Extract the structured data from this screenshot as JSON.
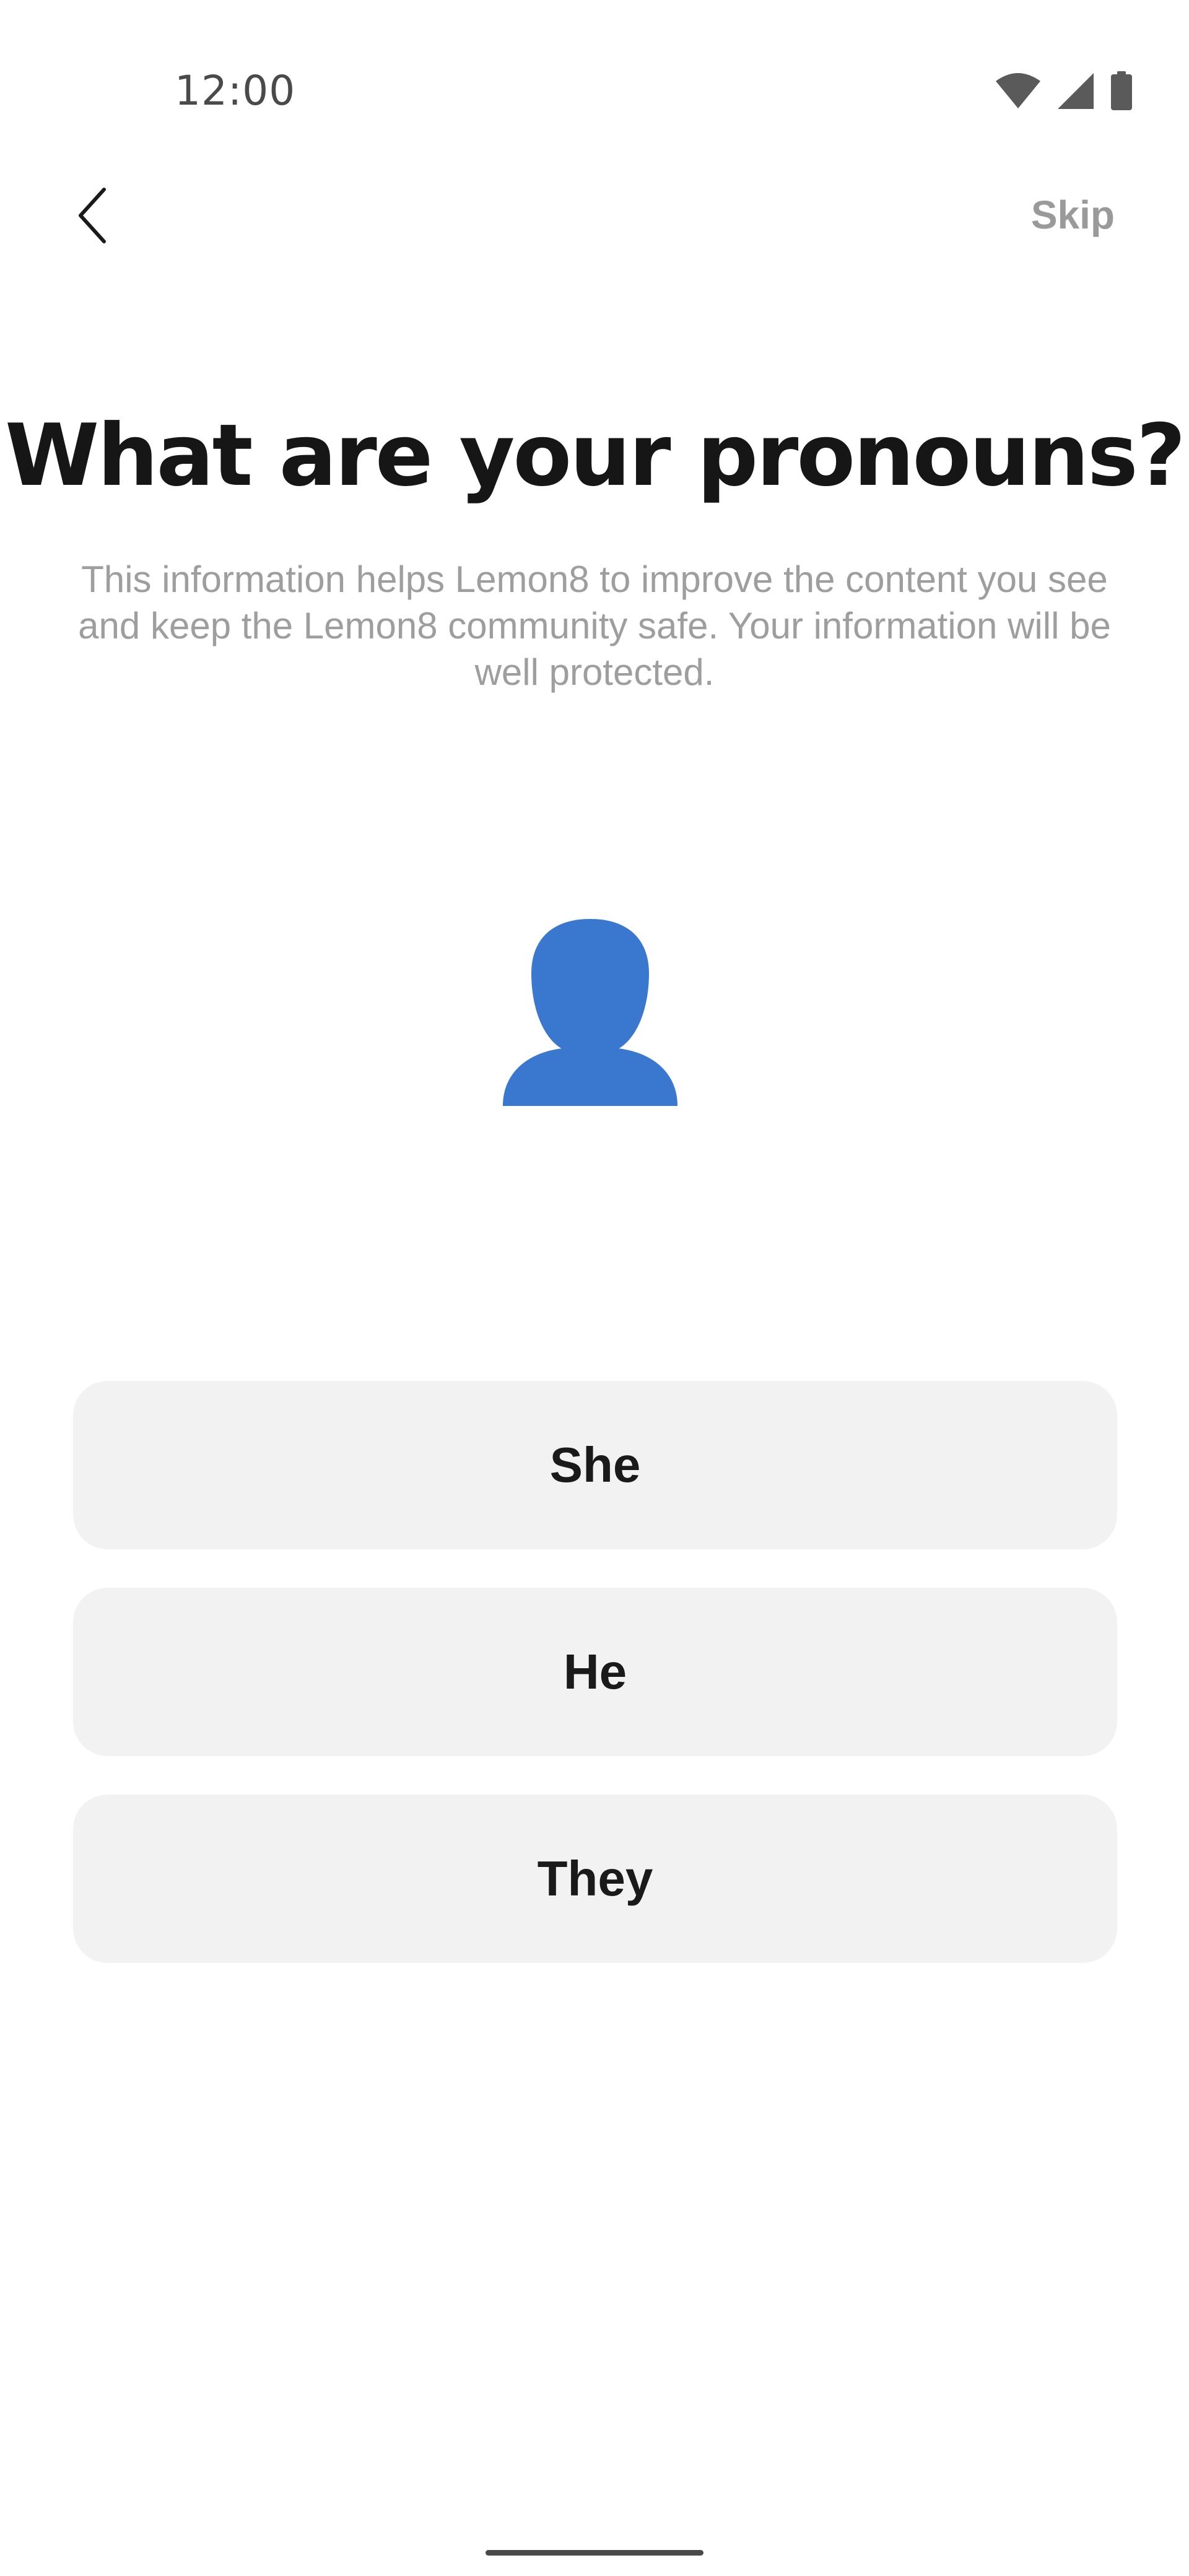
{
  "status_bar": {
    "time": "12:00",
    "icons": [
      "wifi-icon",
      "cellular-signal-icon",
      "battery-icon"
    ]
  },
  "top_bar": {
    "back_icon": "chevron-left-icon",
    "skip_label": "Skip"
  },
  "header": {
    "title": "What are your pronouns?",
    "subtitle": "This information helps Lemon8 to improve the content you see and keep the Lemon8 community safe. Your information will be well protected."
  },
  "avatar": {
    "icon": "person-silhouette-icon",
    "color": "#3a78cf"
  },
  "options": [
    {
      "label": "She"
    },
    {
      "label": "He"
    },
    {
      "label": "They"
    }
  ],
  "colors": {
    "background": "#ffffff",
    "option_background": "#f2f2f2",
    "title": "#161616",
    "subtitle": "#9e9e9e",
    "skip": "#9a9a9a"
  }
}
